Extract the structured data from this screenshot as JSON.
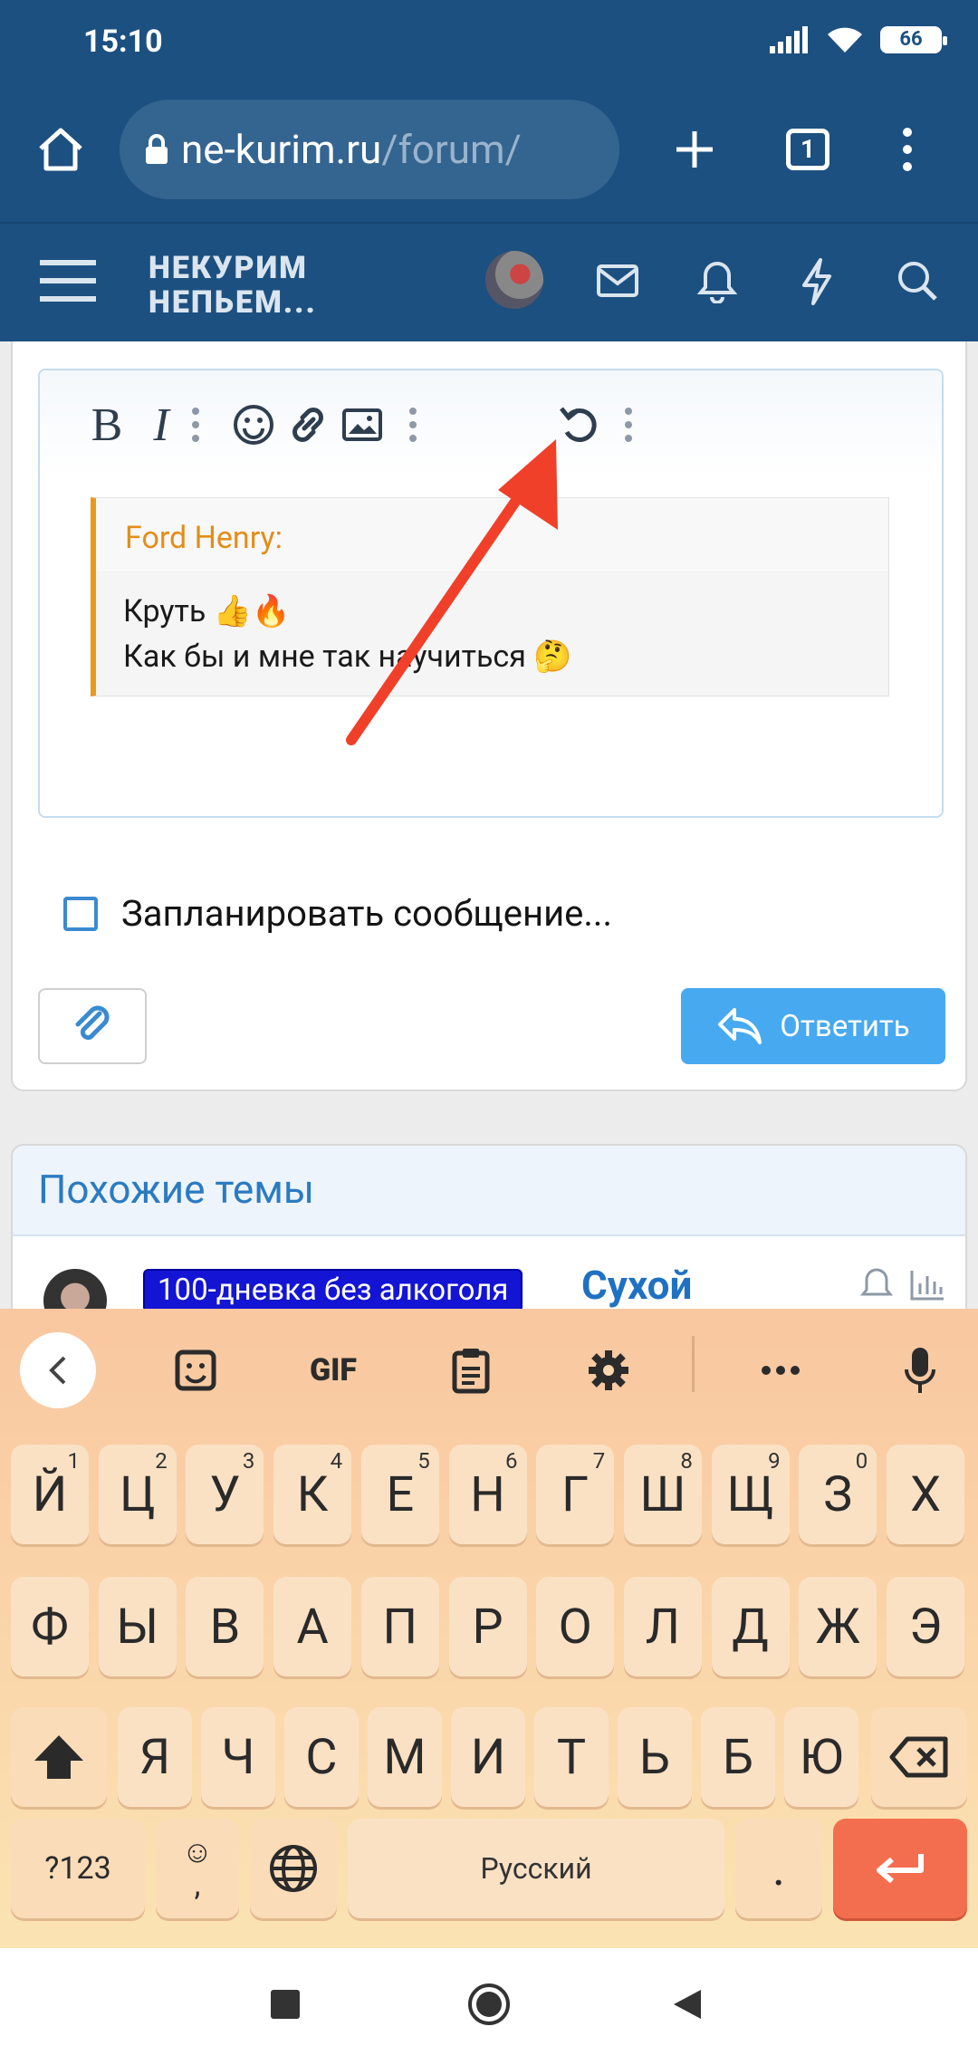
{
  "status": {
    "time": "15:10",
    "battery": "66"
  },
  "browser": {
    "url_host": "ne-kurim.ru",
    "url_path": "/forum/",
    "tab_count": "1"
  },
  "forum": {
    "logo_line1": "НЕКУРИМ",
    "logo_line2": "НЕПЬЕМ..."
  },
  "editor": {
    "quote_author": "Ford Henry:",
    "quote_line1": "Круть 👍🔥",
    "quote_line2": "Как бы и мне так научиться 🤔"
  },
  "reply": {
    "schedule_label": "Запланировать сообщение...",
    "reply_button": "Ответить"
  },
  "similar": {
    "heading": "Похожие темы",
    "thread_prefix": "100-дневка без алкоголя",
    "thread_title": "Сухой"
  },
  "keyboard": {
    "gif_label": "GIF",
    "row1": [
      {
        "k": "Й",
        "h": "1"
      },
      {
        "k": "Ц",
        "h": "2"
      },
      {
        "k": "У",
        "h": "3"
      },
      {
        "k": "К",
        "h": "4"
      },
      {
        "k": "Е",
        "h": "5"
      },
      {
        "k": "Н",
        "h": "6"
      },
      {
        "k": "Г",
        "h": "7"
      },
      {
        "k": "Ш",
        "h": "8"
      },
      {
        "k": "Щ",
        "h": "9"
      },
      {
        "k": "З",
        "h": "0"
      },
      {
        "k": "Х",
        "h": ""
      }
    ],
    "row2": [
      "Ф",
      "Ы",
      "В",
      "А",
      "П",
      "Р",
      "О",
      "Л",
      "Д",
      "Ж",
      "Э"
    ],
    "row3": [
      "Я",
      "Ч",
      "С",
      "М",
      "И",
      "Т",
      "Ь",
      "Б",
      "Ю"
    ],
    "symbols_key": "?123",
    "emoji_key": "☺",
    "comma_key": ",",
    "space_label": "Русский",
    "period_key": "."
  },
  "colors": {
    "browser_bar": "#1c5080",
    "reply_button": "#47a9ef",
    "quote_border": "#e89a1c",
    "enter_key": "#f36e4f",
    "arrow": "#f0402a"
  }
}
